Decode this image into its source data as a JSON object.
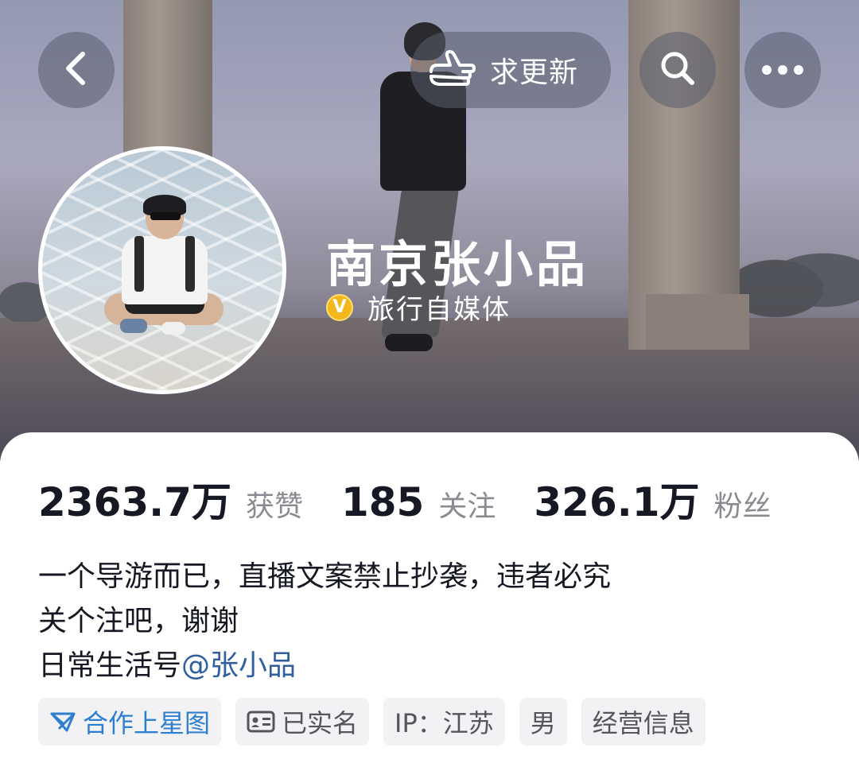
{
  "header": {
    "update_label": "求更新",
    "back_icon": "chevron-left-icon",
    "search_icon": "search-icon",
    "more_icon": "more-horizontal-icon"
  },
  "profile": {
    "name": "南京张小品",
    "verified_badge": "V",
    "verified_label": "旅行自媒体"
  },
  "stats": [
    {
      "value": "2363.7万",
      "label": "获赞"
    },
    {
      "value": "185",
      "label": "关注"
    },
    {
      "value": "326.1万",
      "label": "粉丝"
    }
  ],
  "bio": {
    "line1": "一个导游而已，直播文案禁止抄袭，违者必究",
    "line2": "关个注吧，谢谢",
    "line3_prefix": "日常生活号",
    "line3_mention": "@张小品"
  },
  "tags": [
    {
      "label": "合作上星图",
      "icon": "star-chart-icon"
    },
    {
      "label": "已实名",
      "icon": "id-card-icon"
    },
    {
      "label": "IP：江苏"
    },
    {
      "label": "男"
    },
    {
      "label": "经营信息"
    }
  ],
  "colors": {
    "accent_blue": "#2f7fd0",
    "mention_blue": "#2f5f9e",
    "badge_gold": "#f2b81b",
    "text_dark": "#161823",
    "text_gray": "#8a8b91"
  }
}
